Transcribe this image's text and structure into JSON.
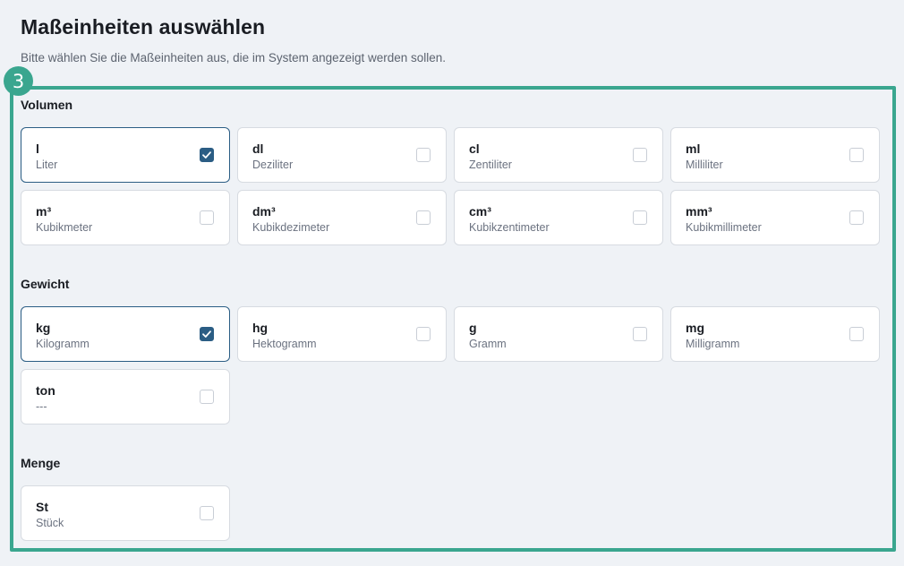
{
  "header": {
    "title": "Maßeinheiten auswählen",
    "subtitle": "Bitte wählen Sie die Maßeinheiten aus, die im System angezeigt werden sollen."
  },
  "step_badge": "3",
  "colors": {
    "accent": "#3aa68f",
    "selected": "#2b5d84"
  },
  "sections": [
    {
      "title": "Volumen",
      "units": [
        {
          "abbr": "l",
          "name": "Liter",
          "checked": true
        },
        {
          "abbr": "dl",
          "name": "Deziliter",
          "checked": false
        },
        {
          "abbr": "cl",
          "name": "Zentiliter",
          "checked": false
        },
        {
          "abbr": "ml",
          "name": "Milliliter",
          "checked": false
        },
        {
          "abbr": "m³",
          "name": "Kubikmeter",
          "checked": false
        },
        {
          "abbr": "dm³",
          "name": "Kubikdezimeter",
          "checked": false
        },
        {
          "abbr": "cm³",
          "name": "Kubikzentimeter",
          "checked": false
        },
        {
          "abbr": "mm³",
          "name": "Kubikmillimeter",
          "checked": false
        }
      ]
    },
    {
      "title": "Gewicht",
      "units": [
        {
          "abbr": "kg",
          "name": "Kilogramm",
          "checked": true
        },
        {
          "abbr": "hg",
          "name": "Hektogramm",
          "checked": false
        },
        {
          "abbr": "g",
          "name": "Gramm",
          "checked": false
        },
        {
          "abbr": "mg",
          "name": "Milligramm",
          "checked": false
        },
        {
          "abbr": "ton",
          "name": "---",
          "checked": false
        }
      ]
    },
    {
      "title": "Menge",
      "units": [
        {
          "abbr": "St",
          "name": "Stück",
          "checked": false
        }
      ]
    }
  ]
}
